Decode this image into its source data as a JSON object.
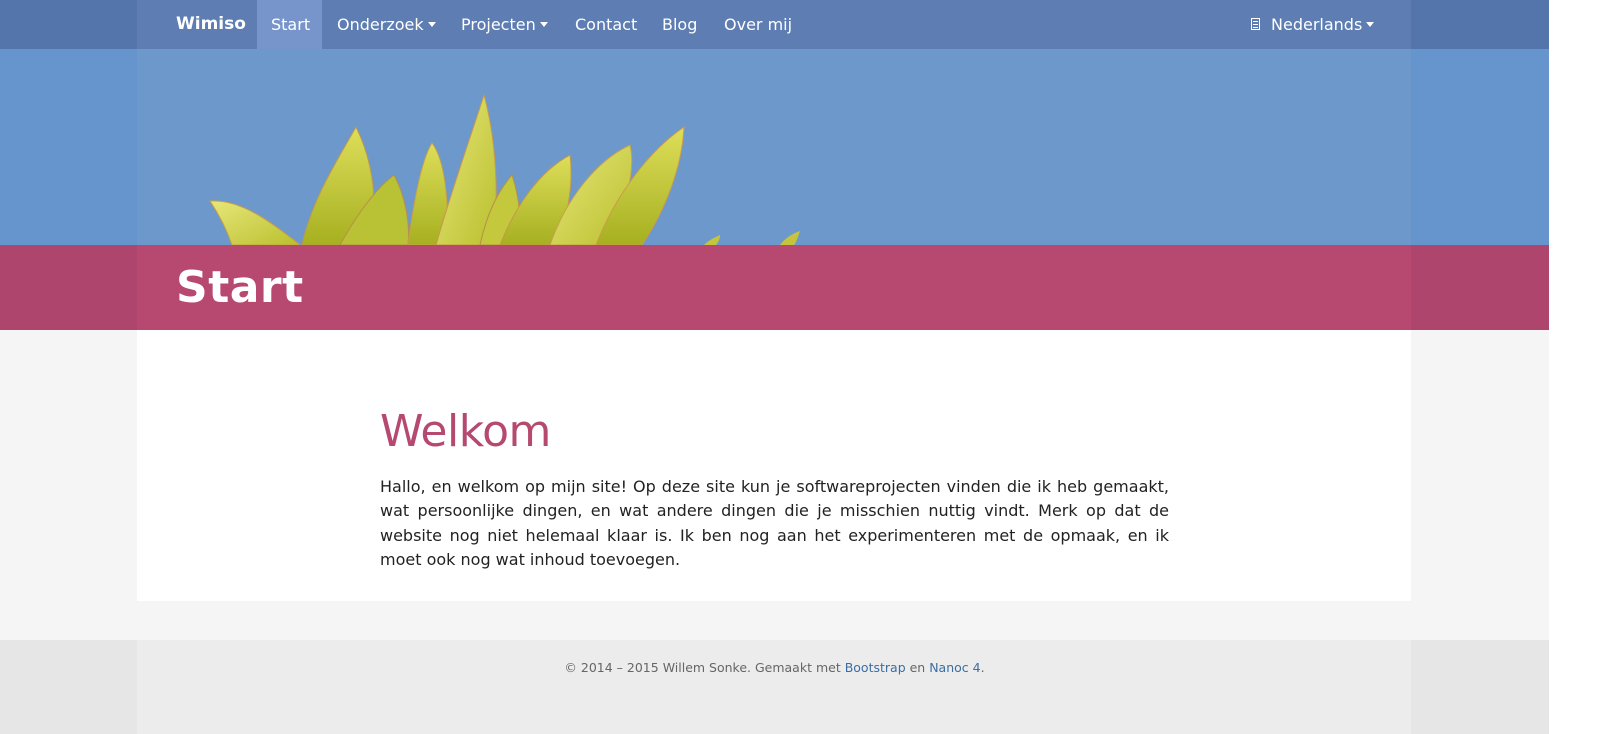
{
  "navbar": {
    "brand": "Wimiso",
    "items": [
      {
        "label": "Start"
      },
      {
        "label": "Onderzoek"
      },
      {
        "label": "Projecten"
      },
      {
        "label": "Contact"
      },
      {
        "label": "Blog"
      },
      {
        "label": "Over mij"
      }
    ],
    "language": "Nederlands"
  },
  "page": {
    "title": "Start",
    "heading": "Welkom",
    "intro": "Hallo, en welkom op mijn site! Op deze site kun je softwareprojecten vinden die ik heb gemaakt, wat per­soonlijke dingen, en wat andere dingen die je misschien nuttig vindt. Merk op dat de website nog niet hele­maal klaar is. Ik ben nog aan het experimenteren met de opmaak, en ik moet ook nog wat inhoud toevoe­gen."
  },
  "footer": {
    "copyright": "© 2014 – 2015  Willem Sonke. Gemaakt met ",
    "link1": "Bootstrap",
    "between": " en ",
    "link2": "Nanoc 4",
    "end": "."
  },
  "colors": {
    "navbar": "#5d7db3",
    "sky": "#6c98cc",
    "title_band": "#b7486f",
    "heading": "#b5496f",
    "link": "#3b6ea5"
  }
}
